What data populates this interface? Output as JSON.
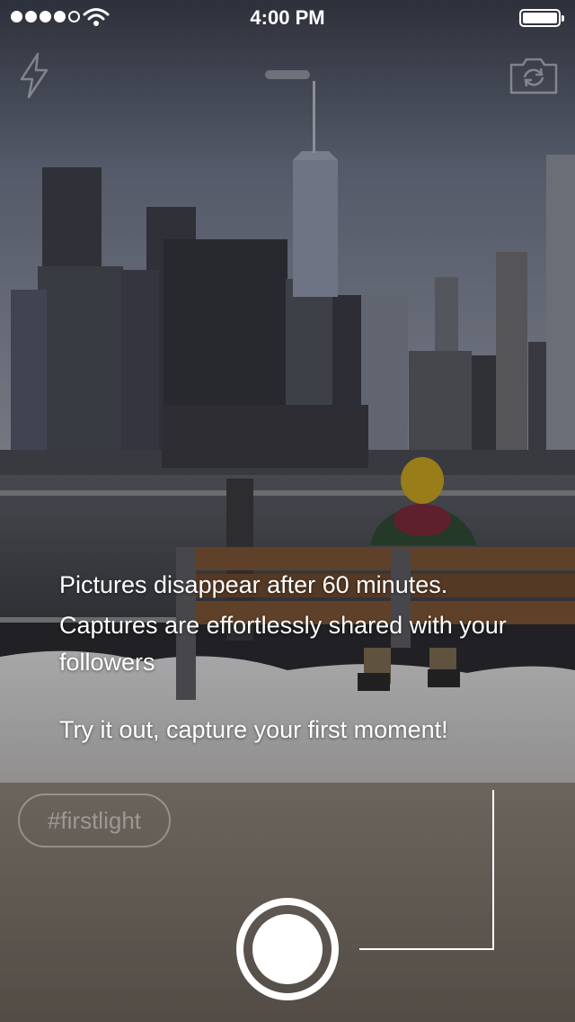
{
  "status_bar": {
    "time": "4:00 PM",
    "signal_strength": 4,
    "signal_max": 5,
    "wifi_icon": "wifi-icon",
    "battery_level": 1.0
  },
  "camera": {
    "flash_icon": "lightning-bolt-icon",
    "switch_camera_icon": "camera-flip-icon",
    "shutter_icon": "shutter-button-icon"
  },
  "intro": {
    "line1": "Pictures disappear after 60 minutes.",
    "line2": "Captures are effortlessly shared with your followers",
    "line3": "Try it out, capture your first moment!"
  },
  "hashtag": {
    "label": "#firstlight"
  },
  "colors": {
    "text": "#ffffff",
    "hashtag_muted": "rgba(255,255,255,0.35)"
  }
}
